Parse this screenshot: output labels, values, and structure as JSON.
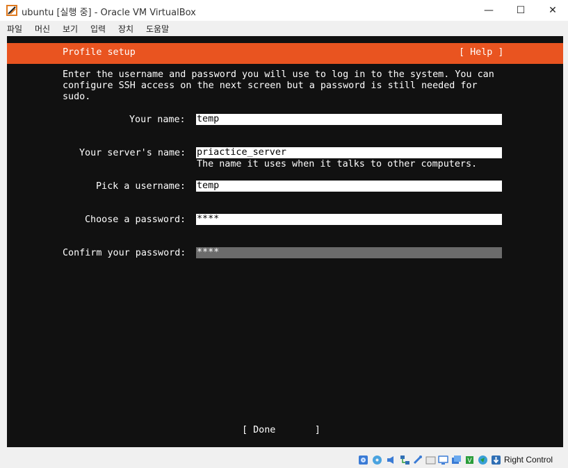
{
  "window": {
    "title": "ubuntu [실행 중] - Oracle VM VirtualBox",
    "minimize": "—",
    "maximize": "☐",
    "close": "✕"
  },
  "menu": [
    "파일",
    "머신",
    "보기",
    "입력",
    "장치",
    "도움말"
  ],
  "installer": {
    "header_title": "Profile setup",
    "help_label": "[ Help ]",
    "intro": "Enter the username and password you will use to log in to the system. You can\nconfigure SSH access on the next screen but a password is still needed for\nsudo.",
    "fields": {
      "name": {
        "label": "Your name:",
        "value": "temp"
      },
      "server": {
        "label": "Your server's name:",
        "value": "priactice_server",
        "hint": "The name it uses when it talks to other computers."
      },
      "username": {
        "label": "Pick a username:",
        "value": "temp"
      },
      "password": {
        "label": "Choose a password:",
        "value": "****"
      },
      "confirm": {
        "label": "Confirm your password:",
        "value": "****"
      }
    },
    "done_button": "[ Done       ]"
  },
  "statusbar": {
    "icons": [
      "hard-disk-icon",
      "optical-drive-icon",
      "audio-icon",
      "network-icon",
      "usb-icon",
      "shared-folders-icon",
      "display-icon",
      "video-capture-icon",
      "cpu-icon",
      "mouse-integration-icon",
      "keyboard-capture-icon"
    ],
    "host_key": "Right Control"
  },
  "colors": {
    "accent": "#e95420",
    "vm_background": "#111111",
    "focused_field": "#6b6b6b"
  }
}
